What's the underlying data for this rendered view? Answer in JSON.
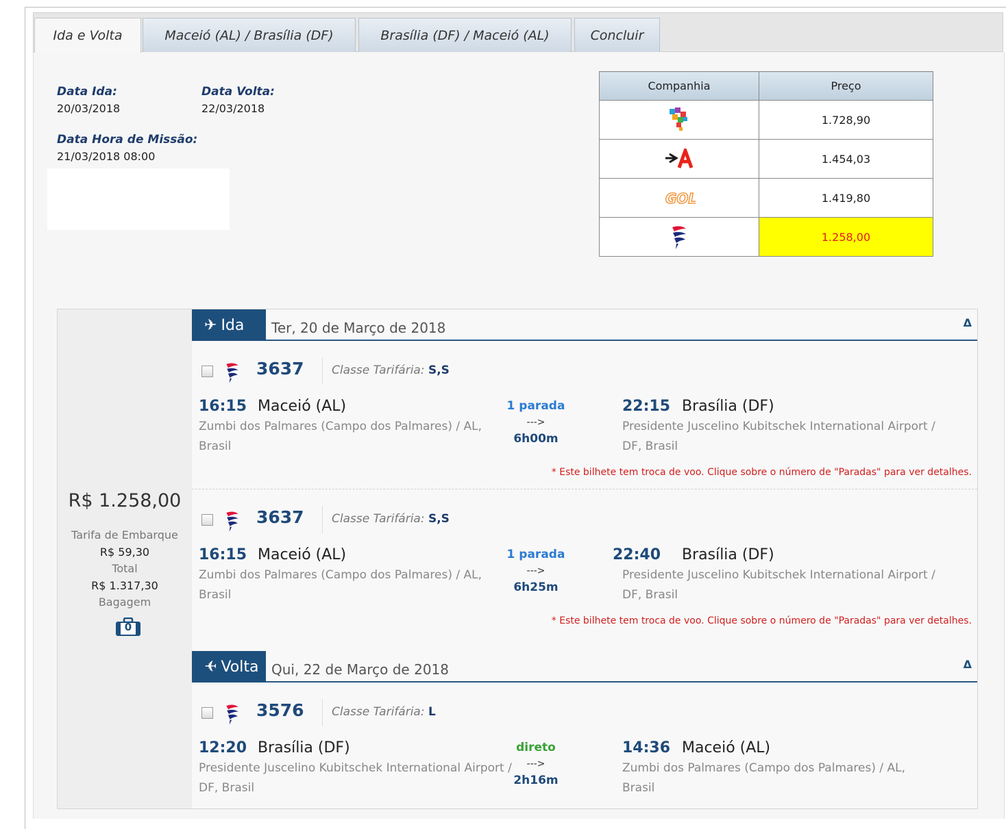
{
  "tabs": [
    {
      "label": "Ida e Volta"
    },
    {
      "label": "Maceió (AL) / Brasília (DF)"
    },
    {
      "label": "Brasília (DF) / Maceió (AL)"
    },
    {
      "label": "Concluir"
    }
  ],
  "dates": {
    "ida_label": "Data Ida:",
    "ida_value": "20/03/2018",
    "volta_label": "Data Volta:",
    "volta_value": "22/03/2018",
    "missao_label": "Data Hora de Missão:",
    "missao_value": "21/03/2018 08:00"
  },
  "price_table": {
    "headers": [
      "Companhia",
      "Preço"
    ],
    "rows": [
      {
        "airline_icon": "avianca-brasil-logo",
        "price": "1.728,90"
      },
      {
        "airline_icon": "azul-logo",
        "price": "1.454,03"
      },
      {
        "airline_icon": "gol-logo",
        "price": "1.419,80"
      },
      {
        "airline_icon": "latam-logo",
        "price": "1.258,00"
      }
    ]
  },
  "summary": {
    "price": "R$ 1.258,00",
    "tarifa_label": "Tarifa de Embarque",
    "tarifa_value": "R$ 59,30",
    "total_label": "Total",
    "total_value": "R$ 1.317,30",
    "bagagem_label": "Bagagem",
    "bagagem_count": "0"
  },
  "ida": {
    "badge": "Ida",
    "date": "Ter, 20 de Março de 2018",
    "collapse": "Δ",
    "flights": [
      {
        "number": "3637",
        "class_label": "Classe Tarifária:",
        "class_value": "S,S",
        "dep_time": "16:15",
        "dep_city": "Maceió (AL)",
        "dep_addr": "Zumbi dos Palmares (Campo dos Palmares) / AL, Brasil",
        "stops": "1 parada",
        "arrow": "--->",
        "duration": "6h00m",
        "arr_time": "22:15",
        "arr_city": "Brasília (DF)",
        "arr_addr": "Presidente Juscelino Kubitschek International Airport / DF, Brasil",
        "note": "* Este bilhete tem troca de voo. Clique sobre o número de \"Paradas\" para ver detalhes."
      },
      {
        "number": "3637",
        "class_label": "Classe Tarifária:",
        "class_value": "S,S",
        "dep_time": "16:15",
        "dep_city": "Maceió (AL)",
        "dep_addr": "Zumbi dos Palmares (Campo dos Palmares) / AL, Brasil",
        "stops": "1 parada",
        "arrow": "--->",
        "duration": "6h25m",
        "arr_time": "22:40",
        "arr_city": "Brasília (DF)",
        "arr_addr": "Presidente Juscelino Kubitschek International Airport / DF, Brasil",
        "note": "* Este bilhete tem troca de voo. Clique sobre o número de \"Paradas\" para ver detalhes."
      }
    ]
  },
  "volta": {
    "badge": "Volta",
    "date": "Qui, 22 de Março de 2018",
    "collapse": "Δ",
    "flights": [
      {
        "number": "3576",
        "class_label": "Classe Tarifária:",
        "class_value": "L",
        "dep_time": "12:20",
        "dep_city": "Brasília (DF)",
        "dep_addr": "Presidente Juscelino Kubitschek International Airport / DF, Brasil",
        "stops": "direto",
        "arrow": "--->",
        "duration": "2h16m",
        "arr_time": "14:36",
        "arr_city": "Maceió (AL)",
        "arr_addr": "Zumbi dos Palmares (Campo dos Palmares) / AL, Brasil"
      }
    ]
  }
}
